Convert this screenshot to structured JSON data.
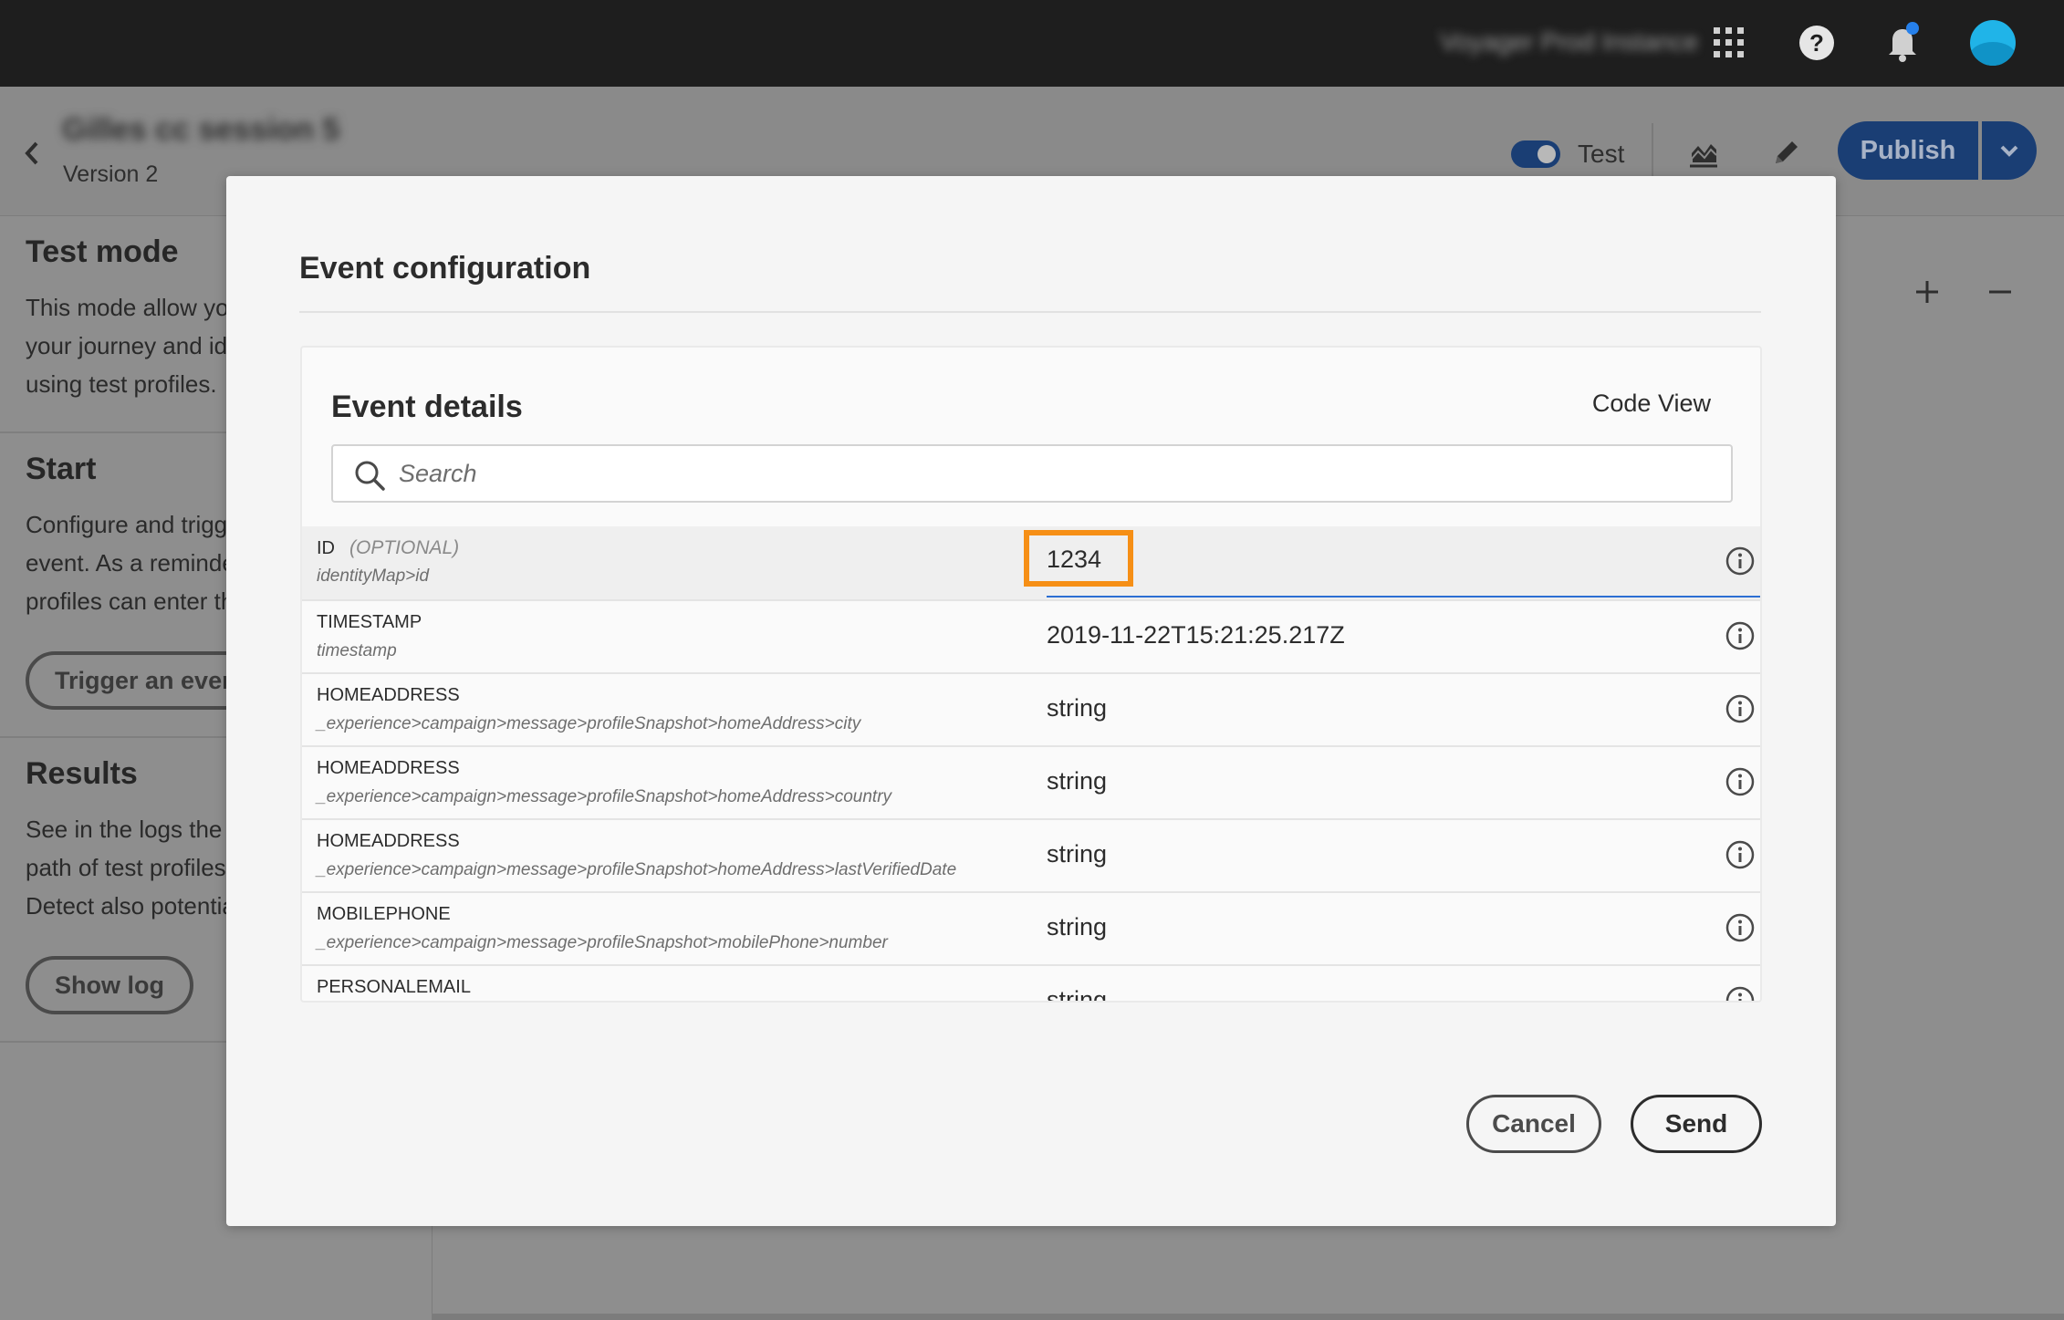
{
  "topbar": {
    "instance_name": "Voyager Prod Instance",
    "icons": [
      "apps-grid-icon",
      "help-icon",
      "notification-bell-icon",
      "user-avatar"
    ],
    "help_glyph": "?"
  },
  "journey": {
    "name": "Gilles cc session 5",
    "version": "Version 2",
    "test_label": "Test",
    "test_enabled": true,
    "publish_label": "Publish"
  },
  "left_panel": {
    "test_mode": {
      "title": "Test mode",
      "lines": [
        "This mode allow yo",
        "your journey and id",
        "using test profiles."
      ]
    },
    "start": {
      "title": "Start",
      "lines": [
        "Configure and trigg",
        "event. As a reminde",
        "profiles can enter th"
      ],
      "button": "Trigger an event"
    },
    "results": {
      "title": "Results",
      "lines": [
        "See in the logs the s",
        "path of test profiles",
        "Detect also potentia"
      ],
      "button": "Show log"
    }
  },
  "canvas": {
    "zoom_in": "+",
    "zoom_out": "−"
  },
  "modal": {
    "title": "Event configuration",
    "details": {
      "title": "Event details",
      "code_view": "Code View",
      "search_placeholder": "Search"
    },
    "rows": [
      {
        "label": "ID",
        "optional": "(OPTIONAL)",
        "path": "identityMap>id",
        "value": "1234",
        "editing": true,
        "highlighted": true
      },
      {
        "label": "TIMESTAMP",
        "path": "timestamp",
        "value": "2019-11-22T15:21:25.217Z"
      },
      {
        "label": "HOMEADDRESS",
        "path": "_experience>campaign>message>profileSnapshot>homeAddress>city",
        "value": "string"
      },
      {
        "label": "HOMEADDRESS",
        "path": "_experience>campaign>message>profileSnapshot>homeAddress>country",
        "value": "string"
      },
      {
        "label": "HOMEADDRESS",
        "path": "_experience>campaign>message>profileSnapshot>homeAddress>lastVerifiedDate",
        "value": "string"
      },
      {
        "label": "MOBILEPHONE",
        "path": "_experience>campaign>message>profileSnapshot>mobilePhone>number",
        "value": "string"
      },
      {
        "label": "PERSONALEMAIL",
        "path": "",
        "value": "string"
      }
    ],
    "cancel_label": "Cancel",
    "send_label": "Send"
  },
  "colors": {
    "topbar_bg": "#1e1e1e",
    "accent_blue": "#1a3e74",
    "input_focus_line": "#2c6ed3",
    "highlight_orange": "#f68f16",
    "notification_dot": "#2680eb",
    "avatar": "#20b4e8"
  }
}
